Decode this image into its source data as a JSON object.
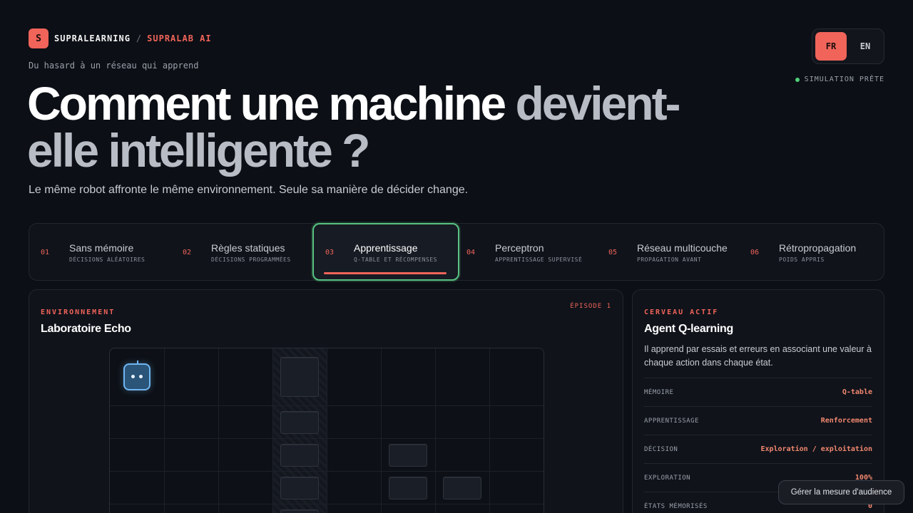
{
  "brand": {
    "logo": "S",
    "name": "SUPRALEARNING",
    "separator": "/",
    "sub": "SUPRALAB AI"
  },
  "tagline": "Du hasard à un réseau qui apprend",
  "hero": {
    "part1": "Comment une machine",
    "part2": "devient-elle intelligente ?"
  },
  "subtitle": "Le même robot affronte le même environnement. Seule sa manière de décider change.",
  "language": {
    "fr": "FR",
    "en": "EN",
    "selected": "FR"
  },
  "status": "SIMULATION PRÊTE",
  "steps": [
    {
      "num": "01",
      "title": "Sans mémoire",
      "sub": "DÉCISIONS ALÉATOIRES"
    },
    {
      "num": "02",
      "title": "Règles statiques",
      "sub": "DÉCISIONS PROGRAMMÉES"
    },
    {
      "num": "03",
      "title": "Apprentissage",
      "sub": "Q-TABLE ET RÉCOMPENSES"
    },
    {
      "num": "04",
      "title": "Perceptron",
      "sub": "APPRENTISSAGE SUPERVISÉ"
    },
    {
      "num": "05",
      "title": "Réseau multicouche",
      "sub": "PROPAGATION AVANT"
    },
    {
      "num": "06",
      "title": "Rétropropagation",
      "sub": "POIDS APPRIS"
    }
  ],
  "active_step": "03",
  "environment": {
    "label": "ENVIRONNEMENT",
    "title": "Laboratoire Echo",
    "episode": "ÉPISODE 1"
  },
  "brain": {
    "label": "CERVEAU ACTIF",
    "title": "Agent Q-learning",
    "description": "Il apprend par essais et erreurs en associant une valeur à chaque action dans chaque état.",
    "rows": [
      {
        "key": "MÉMOIRE",
        "value": "Q-table"
      },
      {
        "key": "APPRENTISSAGE",
        "value": "Renforcement"
      },
      {
        "key": "DÉCISION",
        "value": "Exploration / exploitation"
      },
      {
        "key": "EXPLORATION",
        "value": "100%"
      },
      {
        "key": "ÉTATS MÉMORISÉS",
        "value": "0"
      }
    ]
  },
  "cookie_button": "Gérer la mesure d'audience",
  "colors": {
    "accent": "#f0645a",
    "active_border": "#58c281",
    "status_dot": "#4fcf7a",
    "robot": "#6fb6f2"
  }
}
